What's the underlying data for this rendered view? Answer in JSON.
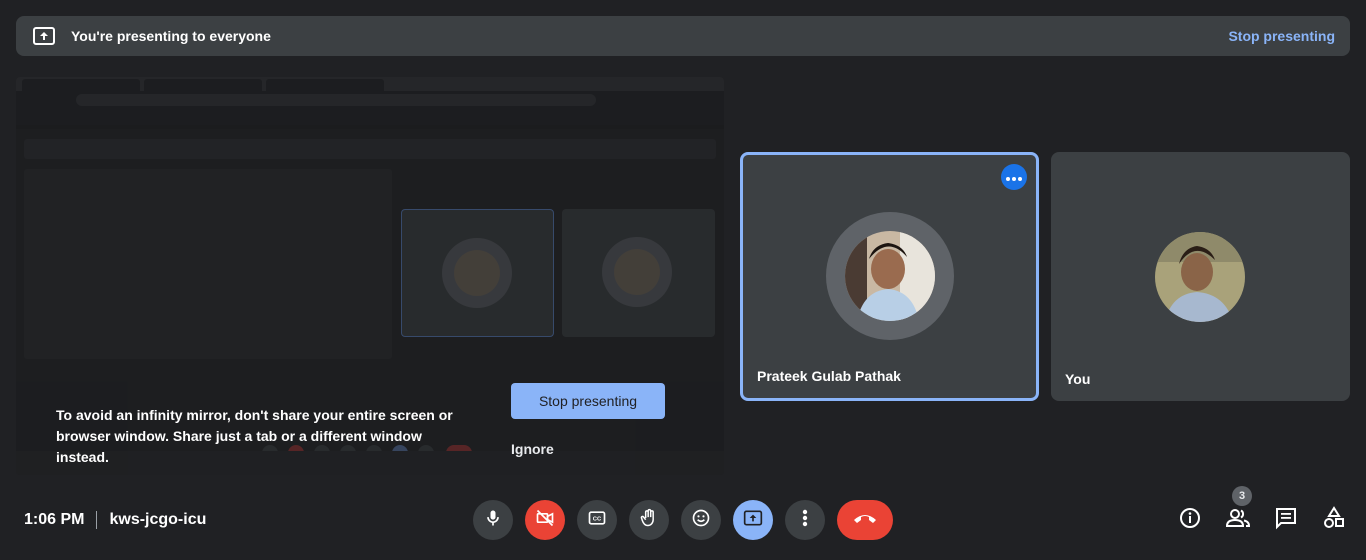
{
  "banner": {
    "title": "You're presenting to everyone",
    "stop_label": "Stop presenting",
    "icon": "present-screen-icon"
  },
  "preview": {
    "note": "To avoid an infinity mirror, don't share your entire screen or browser window. Share just a tab or a different window instead.",
    "stop_label": "Stop presenting",
    "ignore_label": "Ignore"
  },
  "participants": [
    {
      "name": "Prateek Gulab Pathak",
      "active": true,
      "more_icon": "more-horiz-icon"
    },
    {
      "name": "You",
      "active": false
    }
  ],
  "footer": {
    "time": "1:06 PM",
    "meeting_code": "kws-jcgo-icu",
    "people_count": "3"
  },
  "controls": [
    {
      "name": "mic",
      "icon": "mic-icon"
    },
    {
      "name": "camera-off",
      "icon": "videocam-off-icon"
    },
    {
      "name": "captions",
      "icon": "closed-caption-icon"
    },
    {
      "name": "raise-hand",
      "icon": "hand-icon"
    },
    {
      "name": "reactions",
      "icon": "emoji-icon"
    },
    {
      "name": "present",
      "icon": "present-screen-icon"
    },
    {
      "name": "more-options",
      "icon": "more-vert-icon"
    },
    {
      "name": "leave-call",
      "icon": "call-end-icon"
    }
  ],
  "colors": {
    "background": "#202124",
    "surface": "#3c4043",
    "accent": "#8ab4f8",
    "danger": "#ea4335",
    "blue": "#1a73e8"
  }
}
